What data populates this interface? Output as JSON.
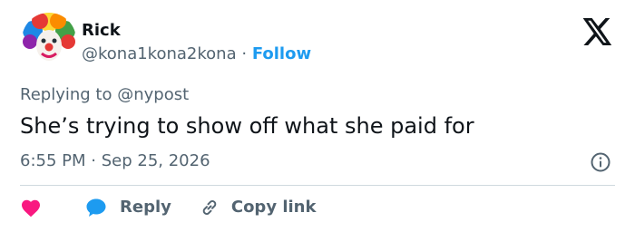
{
  "author": {
    "name": "Rick",
    "handle": "@kona1kona2kona",
    "separator": "·",
    "follow_label": "Follow"
  },
  "reply_context": {
    "prefix": "Replying to",
    "mention": "@nypost"
  },
  "tweet": {
    "text": "She’s trying to show off what she paid for"
  },
  "meta": {
    "time": "6:55 PM",
    "separator": "·",
    "date": "Sep 25, 2026"
  },
  "actions": {
    "reply_label": "Reply",
    "copy_link_label": "Copy link"
  },
  "icons": {
    "logo": "x-logo-icon",
    "info": "info-icon",
    "like": "heart-icon",
    "reply": "speech-bubble-icon",
    "copy": "link-icon"
  },
  "colors": {
    "accent": "#1d9bf0",
    "like": "#f91880",
    "muted": "#536471",
    "text": "#0f1419",
    "divider": "#cfd9de"
  }
}
